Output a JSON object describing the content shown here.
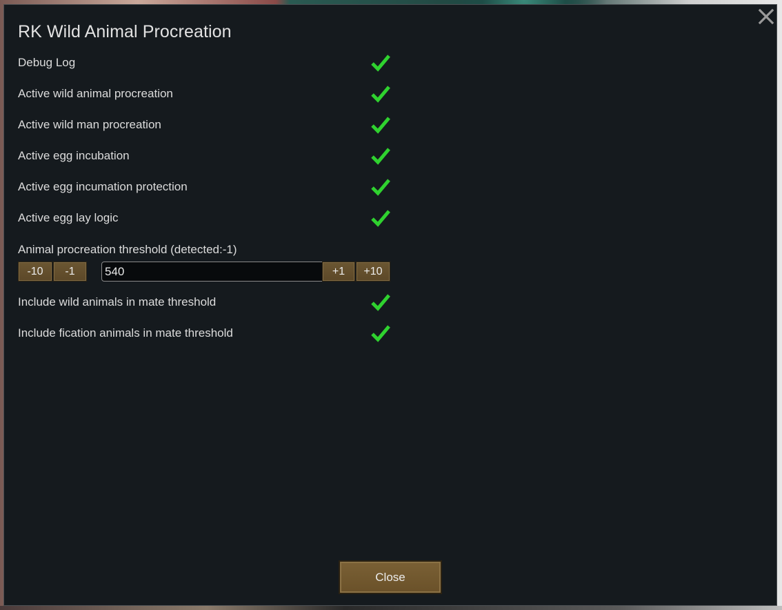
{
  "dialog": {
    "title": "RK Wild Animal Procreation",
    "close_icon": "close-x-icon",
    "close_button_label": "Close"
  },
  "settings": [
    {
      "label": "Debug Log",
      "checked": true
    },
    {
      "label": "Active wild animal procreation",
      "checked": true
    },
    {
      "label": "Active wild man procreation",
      "checked": true
    },
    {
      "label": "Active egg incubation",
      "checked": true
    },
    {
      "label": "Active egg incumation protection",
      "checked": true
    },
    {
      "label": "Active egg lay logic",
      "checked": true
    }
  ],
  "threshold": {
    "label": "Animal procreation threshold (detected:-1)",
    "value": "540",
    "minus10": "-10",
    "minus1": "-1",
    "plus1": "+1",
    "plus10": "+10"
  },
  "mate_settings": [
    {
      "label": "Include wild animals in mate threshold",
      "checked": true
    },
    {
      "label": "Include fication animals in mate threshold",
      "checked": true
    }
  ],
  "colors": {
    "check_green": "#2fd22f",
    "button_brown": "#6b5632",
    "panel_bg": "#151a1e"
  }
}
